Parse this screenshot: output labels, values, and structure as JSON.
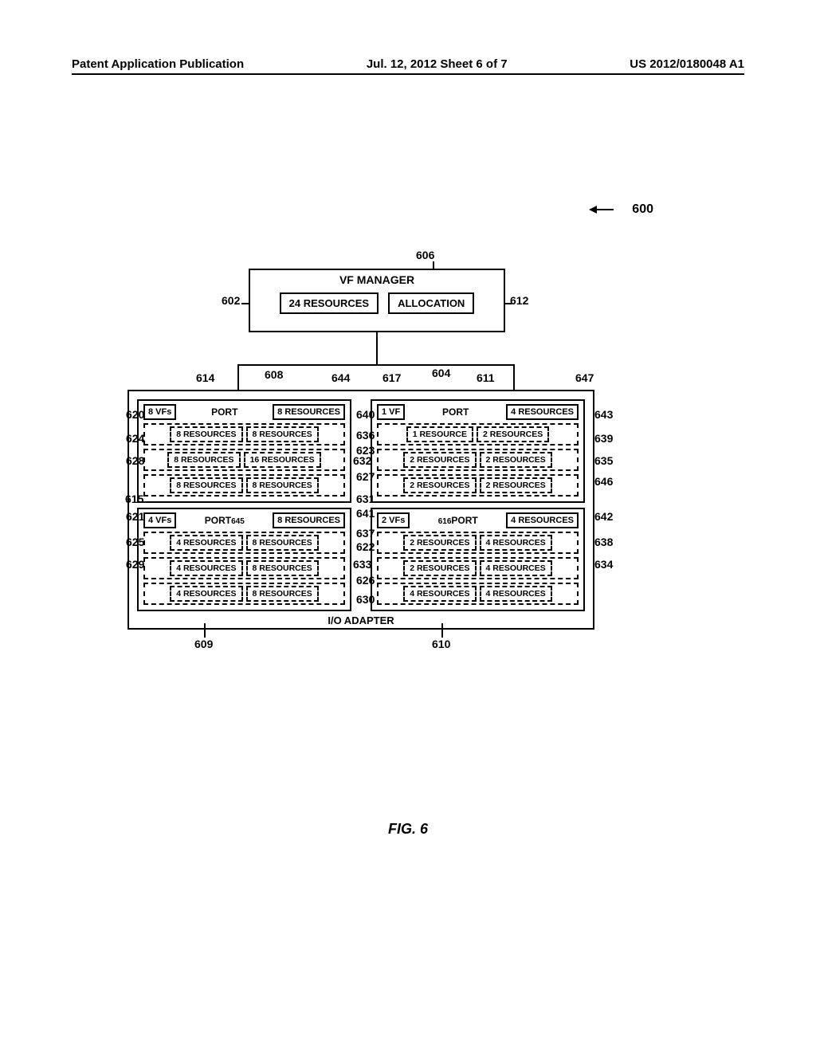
{
  "header": {
    "left": "Patent Application Publication",
    "center": "Jul. 12, 2012  Sheet 6 of 7",
    "right": "US 2012/0180048 A1"
  },
  "fig_caption": "FIG. 6",
  "fig_ref": "600",
  "vf_manager": {
    "title": "VF MANAGER",
    "resources": "24 RESOURCES",
    "allocation": "ALLOCATION"
  },
  "io_adapter_label": "I/O ADAPTER",
  "ports": [
    {
      "vfs": "8 VFs",
      "title": "PORT",
      "res": "8 RESOURCES",
      "rows": [
        {
          "l": "8 RESOURCES",
          "r": "8 RESOURCES"
        },
        {
          "l": "8 RESOURCES",
          "r": "16 RESOURCES"
        },
        {
          "l": "8 RESOURCES",
          "r": "8 RESOURCES"
        }
      ]
    },
    {
      "vfs": "1 VF",
      "title": "PORT",
      "res": "4 RESOURCES",
      "rows": [
        {
          "l": "1 RESOURCE",
          "r": "2 RESOURCES"
        },
        {
          "l": "2 RESOURCES",
          "r": "2 RESOURCES"
        },
        {
          "l": "2 RESOURCES",
          "r": "2 RESOURCES"
        }
      ]
    },
    {
      "vfs": "4 VFs",
      "title": "PORT",
      "res": "8 RESOURCES",
      "sub_ref": "645",
      "rows": [
        {
          "l": "4 RESOURCES",
          "r": "8 RESOURCES"
        },
        {
          "l": "4 RESOURCES",
          "r": "8 RESOURCES"
        },
        {
          "l": "4 RESOURCES",
          "r": "8 RESOURCES"
        }
      ]
    },
    {
      "vfs": "2 VFs",
      "title": "PORT",
      "res": "4 RESOURCES",
      "sub_ref": "616",
      "rows": [
        {
          "l": "2 RESOURCES",
          "r": "4 RESOURCES"
        },
        {
          "l": "2 RESOURCES",
          "r": "4 RESOURCES"
        },
        {
          "l": "4 RESOURCES",
          "r": "4 RESOURCES"
        }
      ]
    }
  ],
  "labels": {
    "l602": "602",
    "l606": "606",
    "l612": "612",
    "l614": "614",
    "l608": "608",
    "l644": "644",
    "l617": "617",
    "l604": "604",
    "l611": "611",
    "l647": "647",
    "l620": "620",
    "l640": "640",
    "l643": "643",
    "l624": "624",
    "l636": "636",
    "l639": "639",
    "l628": "628",
    "l623": "623",
    "l632": "632",
    "l635": "635",
    "l627": "627",
    "l646": "646",
    "l615": "615",
    "l631": "631",
    "l621": "621",
    "l641": "641",
    "l642": "642",
    "l625": "625",
    "l637": "637",
    "l622": "622",
    "l638": "638",
    "l629": "629",
    "l633": "633",
    "l626": "626",
    "l634": "634",
    "l630": "630",
    "l609": "609",
    "l610": "610"
  }
}
